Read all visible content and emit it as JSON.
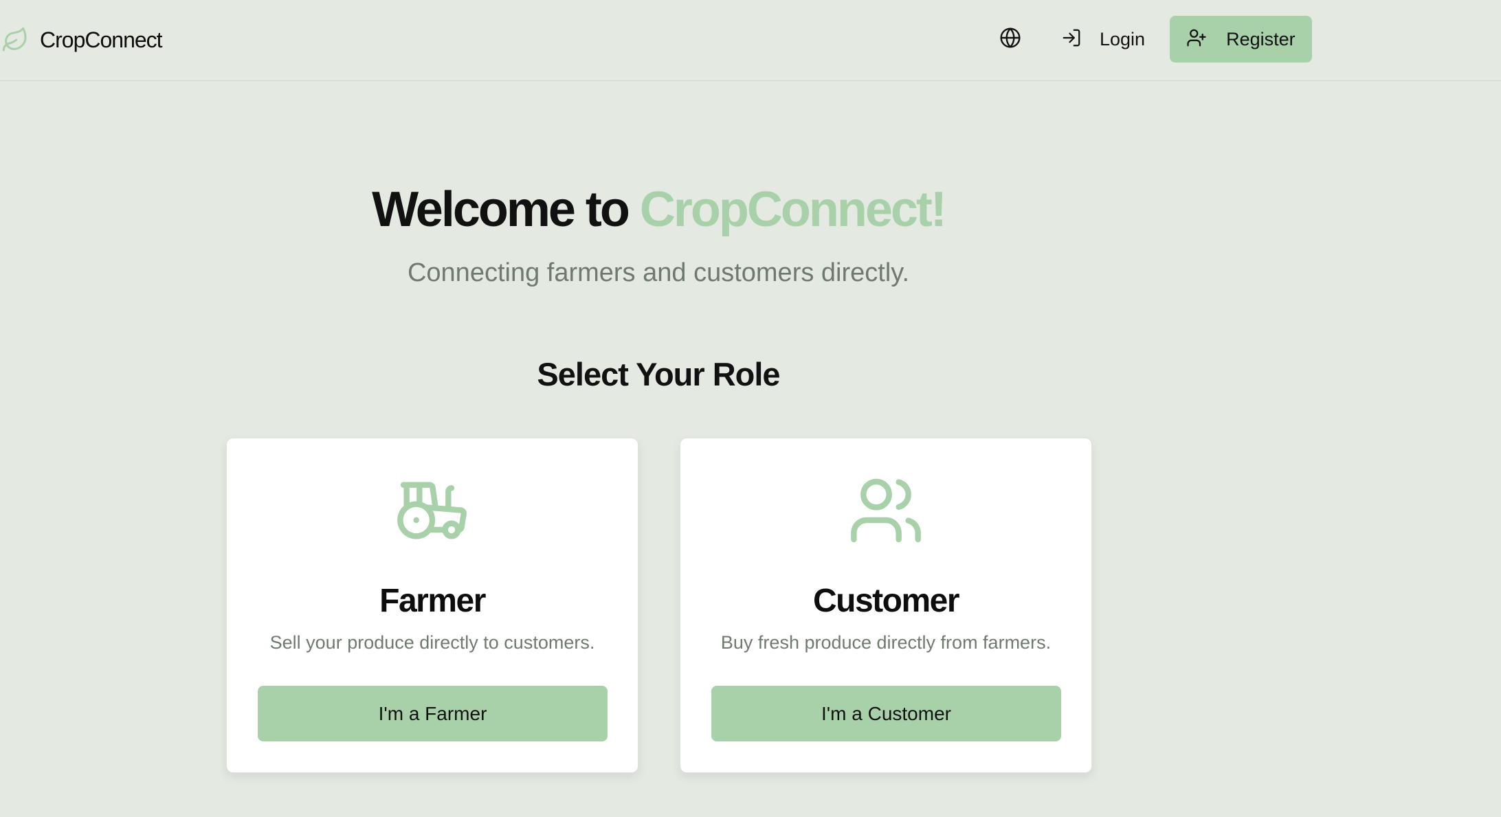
{
  "header": {
    "brand_name": "CropConnect",
    "brand_icon": "leaf-icon",
    "language_icon": "globe-icon",
    "login_label": "Login",
    "login_icon": "log-in-icon",
    "register_label": "Register",
    "register_icon": "user-plus-icon"
  },
  "hero": {
    "title_prefix": "Welcome to ",
    "title_accent": "CropConnect!",
    "subtitle": "Connecting farmers and customers directly."
  },
  "roles": {
    "heading": "Select Your Role",
    "farmer": {
      "icon": "tractor-icon",
      "title": "Farmer",
      "description": "Sell your produce directly to customers.",
      "button_label": "I'm a Farmer"
    },
    "customer": {
      "icon": "users-icon",
      "title": "Customer",
      "description": "Buy fresh produce directly from farmers.",
      "button_label": "I'm a Customer"
    }
  },
  "colors": {
    "background": "#e4e9e2",
    "accent": "#a8d1a9",
    "muted_text": "#6f7a6e",
    "card_background": "#ffffff"
  }
}
